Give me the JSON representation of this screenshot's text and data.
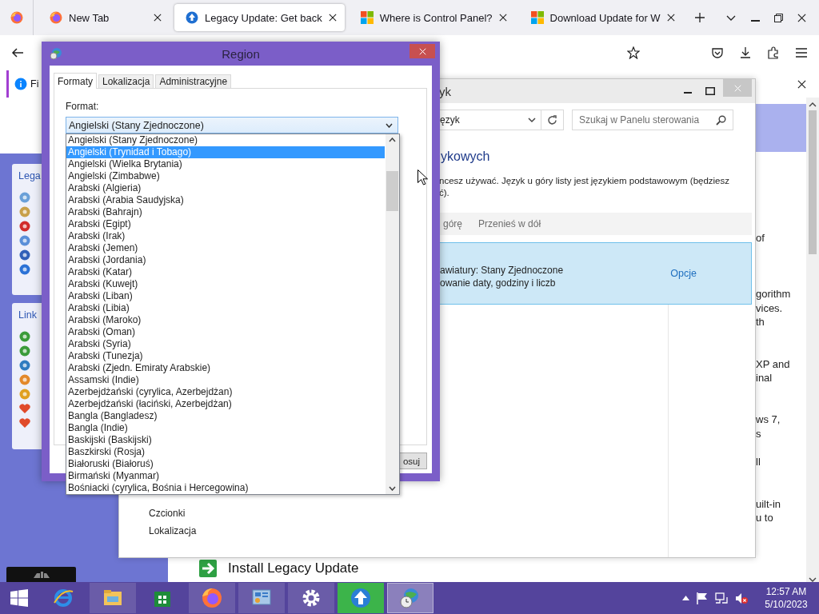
{
  "browser": {
    "tabs": [
      {
        "label": "New Tab",
        "kind": "firefox",
        "selected": false
      },
      {
        "label": "Legacy Update: Get back",
        "kind": "globe",
        "selected": true
      },
      {
        "label": "Where is Control Panel?",
        "kind": "windows",
        "selected": false
      },
      {
        "label": "Download Update for W",
        "kind": "windows",
        "selected": false
      }
    ],
    "notification": {
      "text": "Fi"
    }
  },
  "webpage": {
    "sidebar_boxes": [
      {
        "title": "Lega"
      },
      {
        "title": "Link"
      }
    ],
    "install_link": "Install Legacy Update",
    "right_text": [
      [
        "of"
      ],
      [
        "gorithm",
        "vices.",
        "th"
      ],
      [
        "XP and",
        "inal"
      ],
      [
        "ws 7,",
        "s"
      ],
      [
        "ll"
      ],
      [
        "uilt-in",
        "u to"
      ]
    ]
  },
  "control_panel": {
    "title": "yk",
    "address": "ęzyk",
    "search_placeholder": "Szukaj w Panelu sterowania",
    "heading": "ykowych",
    "description": [
      "ncesz używać. Język u góry listy jest językiem podstawowym (będziesz",
      "ć)."
    ],
    "toolbar": [
      "górę",
      "Przenieś w dół"
    ],
    "language_row": {
      "lines": [
        "awiatury: Stany Zjednoczone",
        "owanie daty, godziny i liczb"
      ],
      "options": "Opcje",
      "selected": true
    },
    "see_also": [
      "Czcionki",
      "Lokalizacja"
    ]
  },
  "region_dialog": {
    "title": "Region",
    "tabs": [
      {
        "label": "Formaty",
        "selected": true
      },
      {
        "label": "Lokalizacja",
        "selected": false
      },
      {
        "label": "Administracyjne",
        "selected": false
      }
    ],
    "format_label": "Format:",
    "format_value": "Angielski (Stany Zjednoczone)",
    "apply_button": "osuj",
    "dropdown": [
      {
        "label": "Angielski (Stany Zjednoczone)",
        "selected": false
      },
      {
        "label": "Angielski (Trynidad i Tobago)",
        "selected": true
      },
      {
        "label": "Angielski (Wielka Brytania)",
        "selected": false
      },
      {
        "label": "Angielski (Zimbabwe)",
        "selected": false
      },
      {
        "label": "Arabski (Algieria)",
        "selected": false
      },
      {
        "label": "Arabski (Arabia Saudyjska)",
        "selected": false
      },
      {
        "label": "Arabski (Bahrajn)",
        "selected": false
      },
      {
        "label": "Arabski (Egipt)",
        "selected": false
      },
      {
        "label": "Arabski (Irak)",
        "selected": false
      },
      {
        "label": "Arabski (Jemen)",
        "selected": false
      },
      {
        "label": "Arabski (Jordania)",
        "selected": false
      },
      {
        "label": "Arabski (Katar)",
        "selected": false
      },
      {
        "label": "Arabski (Kuwejt)",
        "selected": false
      },
      {
        "label": "Arabski (Liban)",
        "selected": false
      },
      {
        "label": "Arabski (Libia)",
        "selected": false
      },
      {
        "label": "Arabski (Maroko)",
        "selected": false
      },
      {
        "label": "Arabski (Oman)",
        "selected": false
      },
      {
        "label": "Arabski (Syria)",
        "selected": false
      },
      {
        "label": "Arabski (Tunezja)",
        "selected": false
      },
      {
        "label": "Arabski (Zjedn. Emiraty Arabskie)",
        "selected": false
      },
      {
        "label": "Assamski (Indie)",
        "selected": false
      },
      {
        "label": "Azerbejdżański (cyrylica, Azerbejdżan)",
        "selected": false
      },
      {
        "label": "Azerbejdżański (łaciński, Azerbejdżan)",
        "selected": false
      },
      {
        "label": "Bangla (Bangladesz)",
        "selected": false
      },
      {
        "label": "Bangla (Indie)",
        "selected": false
      },
      {
        "label": "Baskijski (Baskijski)",
        "selected": false
      },
      {
        "label": "Baszkirski (Rosja)",
        "selected": false
      },
      {
        "label": "Białoruski (Białoruś)",
        "selected": false
      },
      {
        "label": "Birmański (Myanmar)",
        "selected": false
      },
      {
        "label": "Bośniacki (cyrylica, Bośnia i Hercegowina)",
        "selected": false
      }
    ]
  },
  "taskbar": {
    "apps": [
      {
        "kind": "ie",
        "running": false,
        "selected": false,
        "flashing": false
      },
      {
        "kind": "explorer",
        "running": true,
        "selected": false,
        "flashing": false
      },
      {
        "kind": "store",
        "running": false,
        "selected": false,
        "flashing": false
      },
      {
        "kind": "firefox",
        "running": true,
        "selected": false,
        "flashing": false
      },
      {
        "kind": "control-panel",
        "running": true,
        "selected": false,
        "flashing": false
      },
      {
        "kind": "settings",
        "running": true,
        "selected": false,
        "flashing": false
      },
      {
        "kind": "legacy-update",
        "running": true,
        "selected": false,
        "flashing": true
      },
      {
        "kind": "region",
        "running": true,
        "selected": true,
        "flashing": false
      }
    ],
    "time": "12:57 AM",
    "date": "5/10/2023"
  }
}
